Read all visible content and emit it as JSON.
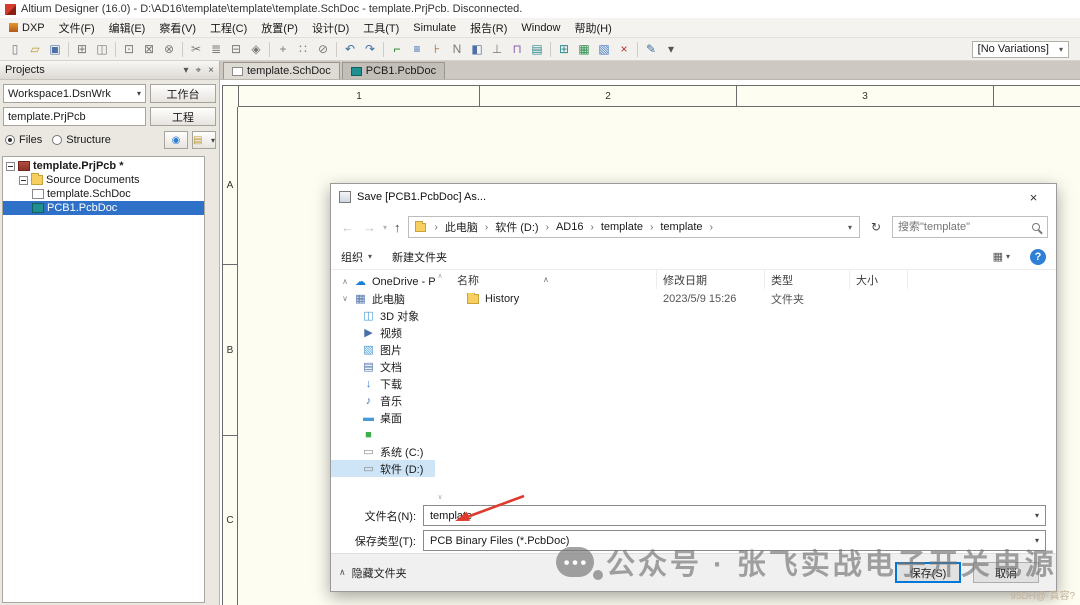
{
  "window": {
    "title": "Altium Designer (16.0) - D:\\AD16\\template\\template\\template.SchDoc - template.PrjPcb. Disconnected."
  },
  "menu": {
    "items": [
      "DXP",
      "文件(F)",
      "编辑(E)",
      "察看(V)",
      "工程(C)",
      "放置(P)",
      "设计(D)",
      "工具(T)",
      "Simulate",
      "报告(R)",
      "Window",
      "帮助(H)"
    ]
  },
  "toolbar": {
    "no_variations": "[No Variations]",
    "caret": "▾",
    "icons": [
      {
        "name": "new-document-icon",
        "glyph": "▯",
        "color": "#7a7a7a"
      },
      {
        "name": "open-document-icon",
        "glyph": "▱",
        "color": "#bd962f"
      },
      {
        "name": "save-icon",
        "glyph": "▣",
        "color": "#4f6fa8"
      },
      {
        "sep": true
      },
      {
        "name": "print-icon",
        "glyph": "⊞",
        "color": "#7a7a7a"
      },
      {
        "name": "print-preview-icon",
        "glyph": "◫",
        "color": "#7a7a7a"
      },
      {
        "sep": true
      },
      {
        "name": "zoom-window-icon",
        "glyph": "⊡",
        "color": "#7a7a7a"
      },
      {
        "name": "zoom-fit-icon",
        "glyph": "⊠",
        "color": "#7a7a7a"
      },
      {
        "name": "cross-probe-icon",
        "glyph": "⊗",
        "color": "#7a7a7a"
      },
      {
        "sep": true
      },
      {
        "name": "cut-icon",
        "glyph": "✂",
        "color": "#7a7a7a"
      },
      {
        "name": "copy-icon",
        "glyph": "≣",
        "color": "#7a7a7a"
      },
      {
        "name": "paste-icon",
        "glyph": "⊟",
        "color": "#7a7a7a"
      },
      {
        "name": "rubber-stamp-icon",
        "glyph": "◈",
        "color": "#7a7a7a"
      },
      {
        "sep": true
      },
      {
        "name": "move-icon",
        "glyph": "+",
        "color": "#7a7a7a"
      },
      {
        "name": "select-icon",
        "glyph": "∷",
        "color": "#7a7a7a"
      },
      {
        "name": "deselect-icon",
        "glyph": "⊘",
        "color": "#7a7a7a"
      },
      {
        "sep": true
      },
      {
        "name": "undo-icon",
        "glyph": "↶",
        "color": "#3a6ea5"
      },
      {
        "name": "redo-icon",
        "glyph": "↷",
        "color": "#3a6ea5"
      },
      {
        "sep": true
      },
      {
        "name": "wire-icon",
        "glyph": "⌐",
        "color": "#1f7a1f"
      },
      {
        "name": "bus-icon",
        "glyph": "≡",
        "color": "#2b5fb0"
      },
      {
        "name": "signal-harness-icon",
        "glyph": "⊦",
        "color": "#b06a2b"
      },
      {
        "name": "net-label-icon",
        "glyph": "N",
        "color": "#7a7a7a"
      },
      {
        "name": "port-icon",
        "glyph": "◧",
        "color": "#4f6fa8"
      },
      {
        "name": "power-port-icon",
        "glyph": "⊥",
        "color": "#7a7a7a"
      },
      {
        "name": "part-icon",
        "glyph": "⊓",
        "color": "#8a5fb0"
      },
      {
        "name": "sheet-symbol-icon",
        "glyph": "▤",
        "color": "#2b8a8a"
      },
      {
        "sep": true
      },
      {
        "name": "grid-icon",
        "glyph": "⊞",
        "color": "#2b8a8a"
      },
      {
        "name": "board-icon",
        "glyph": "▦",
        "color": "#2f8f4f"
      },
      {
        "name": "room-icon",
        "glyph": "▧",
        "color": "#3f77c4"
      },
      {
        "name": "close-document-icon",
        "glyph": "×",
        "color": "#b0302b"
      },
      {
        "sep": true
      },
      {
        "name": "pencil-icon",
        "glyph": "✎",
        "color": "#3a6ea5"
      },
      {
        "name": "pencil-dropdown-icon",
        "glyph": "▾",
        "color": "#555555"
      }
    ]
  },
  "tabs": [
    {
      "label": "template.SchDoc",
      "icon": "schdoc"
    },
    {
      "label": "PCB1.PcbDoc",
      "icon": "pcbdoc",
      "active": true
    }
  ],
  "projects_panel": {
    "title": "Projects",
    "header_icons": [
      {
        "name": "panel-menu-icon",
        "glyph": "▾"
      },
      {
        "name": "pin-icon",
        "glyph": "⌖"
      },
      {
        "name": "close-icon",
        "glyph": "×"
      }
    ],
    "workspace_combo": "Workspace1.DsnWrk",
    "workspace_button": "工作台",
    "combo_caret": "▾",
    "project_combo": "template.PrjPcb",
    "project_button": "工程",
    "radio_files": "Files",
    "radio_structure": "Structure",
    "explorer_button_glyph": "◉",
    "docs_button_glyph": "▤",
    "tree": [
      {
        "label": "template.PrjPcb *",
        "icon": "project",
        "level": 0,
        "expander": true,
        "bold": true
      },
      {
        "label": "Source Documents",
        "icon": "folder",
        "level": 1,
        "expander": true
      },
      {
        "label": "template.SchDoc",
        "icon": "schdoc",
        "level": 2
      },
      {
        "label": "PCB1.PcbDoc",
        "icon": "pcbdoc",
        "level": 2,
        "selected": true
      }
    ]
  },
  "sheet": {
    "columns": [
      "1",
      "2",
      "3"
    ],
    "rows": [
      "A",
      "B",
      "C"
    ]
  },
  "dialog": {
    "title": "Save [PCB1.PcbDoc] As...",
    "close_glyph": "×",
    "nav": {
      "back": "←",
      "forward": "→",
      "dropdown": "▾",
      "up": "↑",
      "refresh": "↻"
    },
    "crumb_chevron": "›",
    "breadcrumb": [
      "此电脑",
      "软件 (D:)",
      "AD16",
      "template",
      "template"
    ],
    "search": "搜索\"template\"",
    "organize": "组织",
    "new_folder": "新建文件夹",
    "view_glyph": "▦",
    "help_glyph": "?",
    "scroll_up": "∧",
    "scroll_down": "∨",
    "sidebar": [
      {
        "label": "OneDrive - Pers",
        "icon": "cloud",
        "glyph": "☁",
        "color": "#1a7fd4",
        "chevron": "∧",
        "level": 0
      },
      {
        "label": "此电脑",
        "icon": "computer",
        "glyph": "▦",
        "color": "#4a6fa8",
        "chevron": "∨",
        "level": 0
      },
      {
        "label": "3D 对象",
        "icon": "3d-objects",
        "glyph": "◫",
        "color": "#4a9ad4",
        "level": 1
      },
      {
        "label": "视频",
        "icon": "videos",
        "glyph": "▶",
        "color": "#4a6fa8",
        "level": 1
      },
      {
        "label": "图片",
        "icon": "pictures",
        "glyph": "▧",
        "color": "#4a9ad4",
        "level": 1
      },
      {
        "label": "文档",
        "icon": "documents",
        "glyph": "▤",
        "color": "#4a6fa8",
        "level": 1
      },
      {
        "label": "下载",
        "icon": "downloads",
        "glyph": "↓",
        "color": "#2b7fd4",
        "level": 1
      },
      {
        "label": "音乐",
        "icon": "music",
        "glyph": "♪",
        "color": "#4a6fa8",
        "level": 1
      },
      {
        "label": "桌面",
        "icon": "desktop",
        "glyph": "▬",
        "color": "#4a9ad4",
        "level": 1
      },
      {
        "label": "",
        "icon": "folder-green",
        "glyph": "■",
        "color": "#3fae49",
        "level": 1
      },
      {
        "label": "系统 (C:)",
        "icon": "drive-c",
        "glyph": "▭",
        "color": "#8a8a8a",
        "level": 1
      },
      {
        "label": "软件 (D:)",
        "icon": "drive-d",
        "glyph": "▭",
        "color": "#8a8a8a",
        "level": 1,
        "selected": true
      }
    ],
    "columns": [
      "名称",
      "修改日期",
      "类型",
      "大小"
    ],
    "sort_glyph": "∧",
    "files": [
      {
        "name": "History",
        "date": "2023/5/9 15:26",
        "type": "文件夹",
        "size": ""
      }
    ],
    "filename_label": "文件名(N):",
    "filename_value": "template",
    "filetype_label": "保存类型(T):",
    "filetype_value": "PCB Binary Files (*.PcbDoc)",
    "combo_caret": "▾",
    "hide_folders": "隐藏文件夹",
    "hide_chevron": "∧",
    "save_button": "保存(S)",
    "cancel_button": "取消"
  },
  "watermark": {
    "text": "公众号 · 张飞实战电子开关电源",
    "corner": "95DH@·真容?"
  }
}
